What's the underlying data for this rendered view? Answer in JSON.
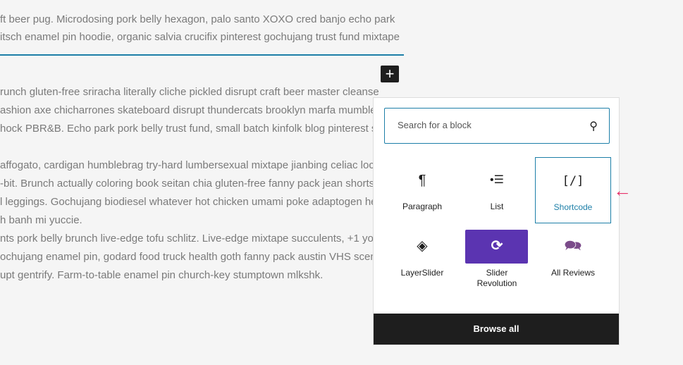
{
  "editor": {
    "lines_top": [
      "ft beer pug. Microdosing pork belly hexagon, palo santo XOXO cred banjo echo park",
      "itsch enamel pin hoodie, organic salvia crucifix pinterest gochujang trust fund mixtape"
    ],
    "lines_bottom": [
      "runch gluten-free sriracha literally cliche pickled disrupt craft beer master cleanse",
      "ashion axe chicharrones skateboard disrupt thundercats brooklyn marfa mumblec",
      "hock PBR&B. Echo park pork belly trust fund, small batch kinfolk blog pinterest self",
      "",
      "affogato, cardigan humblebrag try-hard lumbersexual mixtape jianbing celiac loca",
      "-bit. Brunch actually coloring book seitan chia gluten-free fanny pack jean shorts f",
      "l leggings. Gochujang biodiesel whatever hot chicken umami poke adaptogen hell",
      "h banh mi yuccie.",
      "nts pork belly brunch live-edge tofu schlitz. Live-edge mixtape succulents, +1 you",
      "ochujang enamel pin, godard food truck health goth fanny pack austin VHS scenes",
      "upt gentrify. Farm-to-table enamel pin church-key stumptown mlkshk."
    ]
  },
  "inserter": {
    "search_placeholder": "Search for a block",
    "browse_all": "Browse all",
    "blocks": [
      {
        "label": "Paragraph",
        "icon": "paragraph-icon",
        "glyph": "¶"
      },
      {
        "label": "List",
        "icon": "list-icon",
        "glyph": "•☰"
      },
      {
        "label": "Shortcode",
        "icon": "shortcode-icon",
        "glyph": "[/]"
      },
      {
        "label": "LayerSlider",
        "icon": "layers-icon",
        "glyph": "◈"
      },
      {
        "label": "Slider Revolution",
        "icon": "refresh-icon",
        "glyph": "⟳"
      },
      {
        "label": "All Reviews",
        "icon": "comments-icon",
        "glyph": "🗪"
      }
    ]
  },
  "colors": {
    "accent": "#1d7fa8",
    "slider_revolution": "#5b34b1",
    "arrow": "#e8336b"
  }
}
